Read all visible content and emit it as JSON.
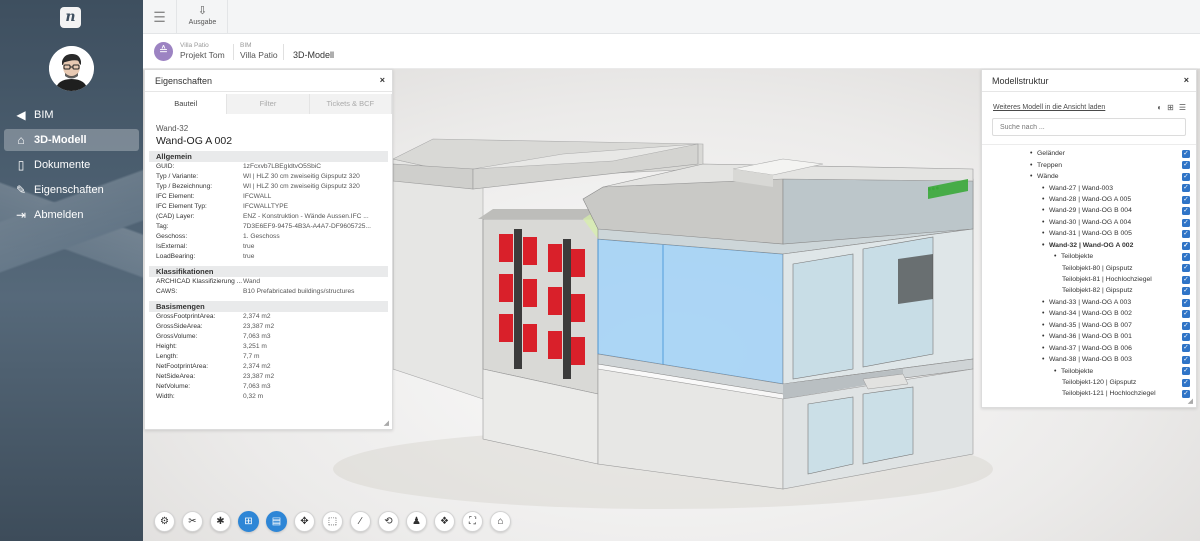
{
  "sidebar": {
    "logo": "n",
    "items": [
      {
        "label": "BIM",
        "icon": "triangle-left-icon"
      },
      {
        "label": "3D-Modell",
        "icon": "house-icon",
        "active": true
      },
      {
        "label": "Dokumente",
        "icon": "document-icon"
      },
      {
        "label": "Eigenschaften",
        "icon": "pencil-icon"
      },
      {
        "label": "Abmelden",
        "icon": "logout-icon"
      }
    ]
  },
  "topbar": {
    "export_label": "Ausgabe"
  },
  "breadcrumb": {
    "project_small": "Villa Patio",
    "project_big": "Projekt Tom",
    "bim_small": "BIM",
    "bim_big": "Villa Patio",
    "current": "3D-Modell"
  },
  "properties_panel": {
    "title": "Eigenschaften",
    "tabs": [
      "Bauteil",
      "Filter",
      "Tickets & BCF"
    ],
    "element_type": "Wand-32",
    "element_name": "Wand-OG A 002",
    "sections": [
      {
        "title": "Allgemein",
        "rows": [
          [
            "GUID:",
            "1zFcxvb7LBEgIdtvO5SbiC"
          ],
          [
            "Typ / Variante:",
            "WI | HLZ 30 cm zweiseitig Gipsputz 320"
          ],
          [
            "Typ / Bezeichnung:",
            "WI | HLZ 30 cm zweiseitig Gipsputz 320"
          ],
          [
            "IFC Element:",
            "IFCWALL"
          ],
          [
            "IFC Element Typ:",
            "IFCWALLTYPE"
          ],
          [
            "(CAD) Layer:",
            "ENZ - Konstruktion - Wände Aussen.IFC ..."
          ],
          [
            "Tag:",
            "7D3E6EF9-9475-4B3A-A4A7-DF9605725..."
          ],
          [
            "Geschoss:",
            "1. Geschoss"
          ],
          [
            "IsExternal:",
            "true"
          ],
          [
            "LoadBearing:",
            "true"
          ]
        ]
      },
      {
        "title": "Klassifikationen",
        "rows": [
          [
            "ARCHICAD Klassifizierung ...",
            "Wand"
          ],
          [
            "CAWS:",
            "B10 Prefabricated buildings/structures"
          ]
        ]
      },
      {
        "title": "Basismengen",
        "rows": [
          [
            "GrossFootprintArea:",
            "2,374 m2"
          ],
          [
            "GrossSideArea:",
            "23,387 m2"
          ],
          [
            "GrossVolume:",
            "7,063 m3"
          ],
          [
            "Height:",
            "3,251 m"
          ],
          [
            "Length:",
            "7,7 m"
          ],
          [
            "NetFootprintArea:",
            "2,374 m2"
          ],
          [
            "NetSideArea:",
            "23,387 m2"
          ],
          [
            "NetVolume:",
            "7,063 m3"
          ],
          [
            "Width:",
            "0,32 m"
          ]
        ]
      }
    ]
  },
  "model_panel": {
    "title": "Modellstruktur",
    "load_link": "Weiteres Modell in die Ansicht laden",
    "search_placeholder": "Suche nach ...",
    "tree": [
      {
        "label": "Geländer",
        "level": 0
      },
      {
        "label": "Treppen",
        "level": 0
      },
      {
        "label": "Wände",
        "level": 0
      },
      {
        "label": "Wand-27 | Wand-003",
        "level": 1
      },
      {
        "label": "Wand-28 | Wand-OG A 005",
        "level": 1
      },
      {
        "label": "Wand-29 | Wand-OG B 004",
        "level": 1
      },
      {
        "label": "Wand-30 | Wand-OG A 004",
        "level": 1
      },
      {
        "label": "Wand-31 | Wand-OG B 005",
        "level": 1
      },
      {
        "label": "Wand-32 | Wand-OG A 002",
        "level": 1,
        "bold": true
      },
      {
        "label": "Teilobjekte",
        "level": 2
      },
      {
        "label": "Teilobjekt-80 | Gipsputz",
        "level": 3
      },
      {
        "label": "Teilobjekt-81 | Hochlochziegel",
        "level": 3
      },
      {
        "label": "Teilobjekt-82 | Gipsputz",
        "level": 3
      },
      {
        "label": "Wand-33 | Wand-OG A 003",
        "level": 1
      },
      {
        "label": "Wand-34 | Wand-OG B 002",
        "level": 1
      },
      {
        "label": "Wand-35 | Wand-OG B 007",
        "level": 1
      },
      {
        "label": "Wand-36 | Wand-OG B 001",
        "level": 1
      },
      {
        "label": "Wand-37 | Wand-OG B 006",
        "level": 1
      },
      {
        "label": "Wand-38 | Wand-OG B 003",
        "level": 1
      },
      {
        "label": "Teilobjekte",
        "level": 2
      },
      {
        "label": "Teilobjekt-120 | Gipsputz",
        "level": 3
      },
      {
        "label": "Teilobjekt-121 | Hochlochziegel",
        "level": 3
      }
    ]
  },
  "toolbar": [
    {
      "name": "settings-tool",
      "glyph": "⚙",
      "active": false
    },
    {
      "name": "tools-tool",
      "glyph": "✂",
      "active": false
    },
    {
      "name": "bug-tool",
      "glyph": "✱",
      "active": false
    },
    {
      "name": "model-tree-tool",
      "glyph": "⊞",
      "active": true
    },
    {
      "name": "properties-tool",
      "glyph": "▤",
      "active": true
    },
    {
      "name": "move-tool",
      "glyph": "✥",
      "active": false
    },
    {
      "name": "section-box-tool",
      "glyph": "⬚",
      "active": false
    },
    {
      "name": "measure-tool",
      "glyph": "∕",
      "active": false
    },
    {
      "name": "orbit-tool",
      "glyph": "⟲",
      "active": false
    },
    {
      "name": "first-person-tool",
      "glyph": "♟",
      "active": false
    },
    {
      "name": "explode-tool",
      "glyph": "❖",
      "active": false
    },
    {
      "name": "fit-view-tool",
      "glyph": "⛶",
      "active": false
    },
    {
      "name": "home-tool",
      "glyph": "⌂",
      "active": false
    }
  ],
  "colors": {
    "sidebar": "#3e4f5f",
    "accent": "#2e86d6",
    "checkbox": "#2f74c7",
    "project_icon": "#9c83c2",
    "facade_red": "#d9202a",
    "glass_blue": "#9fd0f5",
    "roof_text_green": "#3aa83a"
  }
}
